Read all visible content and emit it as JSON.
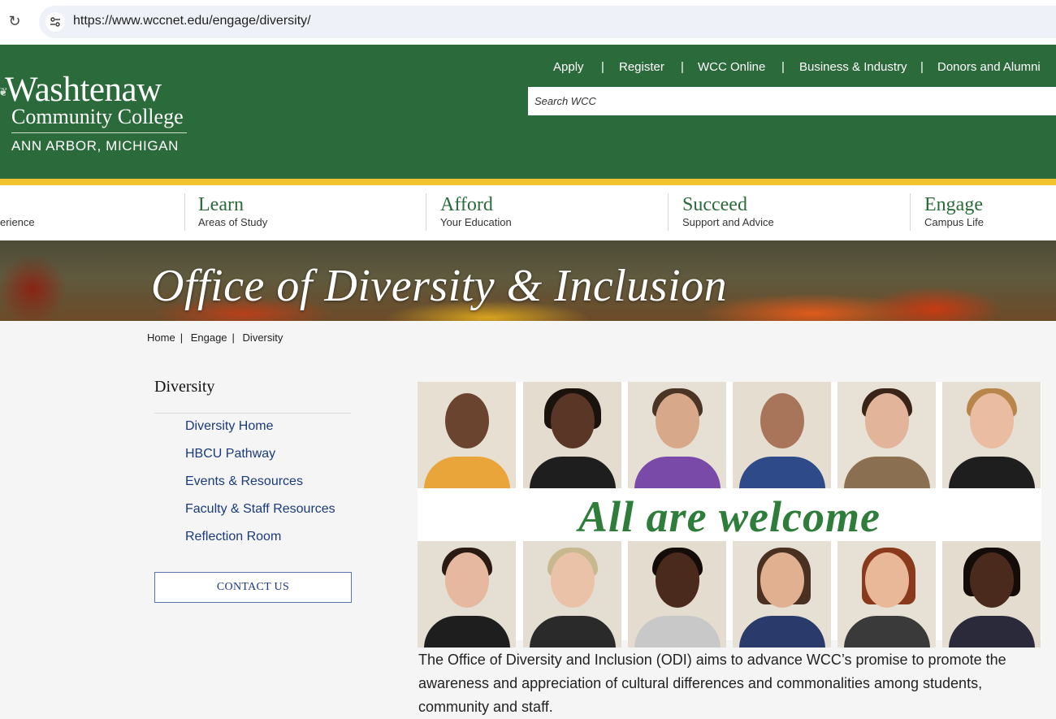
{
  "browser": {
    "url": "https://www.wccnet.edu/engage/diversity/",
    "reload_icon": "reload-icon",
    "site_info_icon": "tune-icon"
  },
  "header": {
    "logo": {
      "line1": "Washtenaw",
      "line2": "Community College",
      "line3": "ANN ARBOR, MICHIGAN"
    },
    "top_links": [
      "Apply",
      "Register",
      "WCC Online",
      "Business & Industry",
      "Donors and Alumni"
    ],
    "separator": "|",
    "search_placeholder": "Search WCC",
    "colors": {
      "green": "#2b6a3a",
      "yellow": "#f2c230"
    }
  },
  "main_nav": [
    {
      "title": "",
      "subtitle": "erience"
    },
    {
      "title": "Learn",
      "subtitle": "Areas of Study"
    },
    {
      "title": "Afford",
      "subtitle": "Your Education"
    },
    {
      "title": "Succeed",
      "subtitle": "Support and Advice"
    },
    {
      "title": "Engage",
      "subtitle": "Campus Life"
    }
  ],
  "hero": {
    "title": "Office of Diversity & Inclusion"
  },
  "breadcrumb": {
    "items": [
      "Home",
      "Engage",
      "Diversity"
    ],
    "separator": "|"
  },
  "sidebar": {
    "title": "Diversity",
    "links": [
      "Diversity Home",
      "HBCU Pathway",
      "Events & Resources",
      "Faculty & Staff Resources",
      "Reflection Room"
    ],
    "contact_button": "CONTACT US"
  },
  "banner": {
    "headline": "All are welcome"
  },
  "intro_text": "The Office of Diversity and Inclusion (ODI) aims to advance WCC’s promise to promote the awareness and appreciation of cultural differences and commonalities among students, community and staff."
}
